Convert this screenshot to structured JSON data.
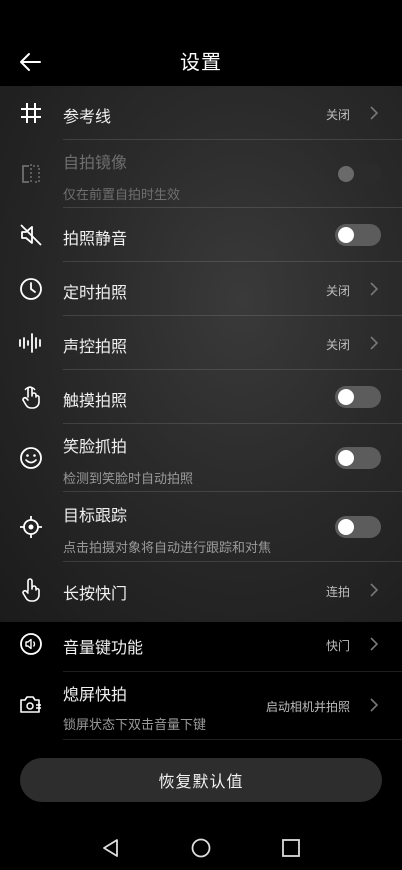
{
  "header": {
    "title": "设置"
  },
  "settings": [
    {
      "label": "参考线",
      "value": "关闭",
      "icon": "grid-icon"
    },
    {
      "label": "自拍镜像",
      "sub": "仅在前置自拍时生效",
      "icon": "mirror-icon",
      "toggle": "disabled"
    },
    {
      "label": "拍照静音",
      "icon": "mute-icon",
      "toggle": "off"
    },
    {
      "label": "定时拍照",
      "value": "关闭",
      "icon": "clock-icon"
    },
    {
      "label": "声控拍照",
      "value": "关闭",
      "icon": "sound-wave-icon"
    },
    {
      "label": "触摸拍照",
      "icon": "touch-icon",
      "toggle": "off"
    },
    {
      "label": "笑脸抓拍",
      "sub": "检测到笑脸时自动拍照",
      "icon": "smile-icon",
      "toggle": "off"
    },
    {
      "label": "目标跟踪",
      "sub": "点击拍摄对象将自动进行跟踪和对焦",
      "icon": "target-icon",
      "toggle": "off"
    },
    {
      "label": "长按快门",
      "value": "连拍",
      "icon": "press-icon"
    },
    {
      "label": "音量键功能",
      "value": "快门",
      "icon": "volume-icon"
    },
    {
      "label": "熄屏快拍",
      "sub": "锁屏状态下双击音量下键",
      "value": "启动相机并拍照",
      "icon": "camera-icon"
    }
  ],
  "reset_label": "恢复默认值",
  "nav": [
    "back-triangle-icon",
    "home-circle-icon",
    "recents-square-icon"
  ]
}
